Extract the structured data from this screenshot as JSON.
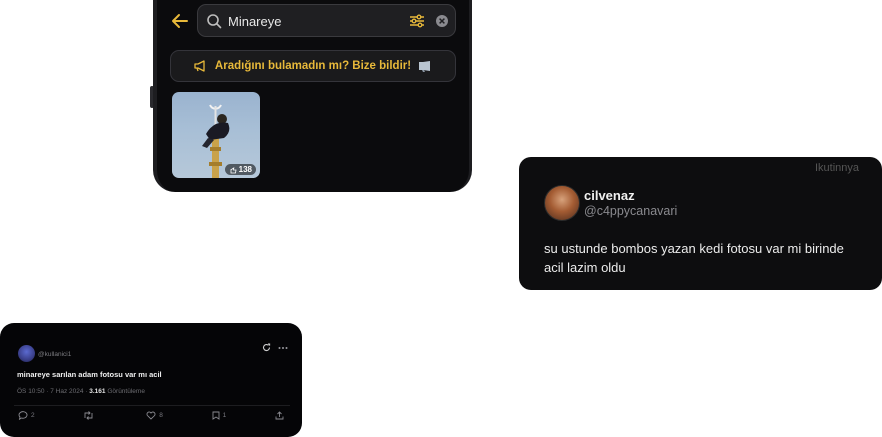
{
  "search_screen": {
    "query": "Minareye",
    "report_banner": "Aradığını bulamadın mı? Bize bildir!",
    "result": {
      "count": "138"
    }
  },
  "tweet_card": {
    "ghost_button": "Ikutinnya",
    "display_name": "cilvenaz",
    "handle": "@c4ppycanavari",
    "text": "su ustunde bombos yazan kedi fotosu var mi birinde acil lazim oldu"
  },
  "mini_tweet": {
    "handle": "@kullanici1",
    "text": "minareye sarılan adam fotosu var mı acil",
    "time": "ÖS 10:50 · 7 Haz 2024 · ",
    "views": "3.161",
    "views_label": " Görüntüleme",
    "actions": {
      "replies": "2",
      "retweets": "",
      "likes": "8",
      "bookmarks": "1"
    }
  },
  "colors": {
    "accent_yellow": "#e8b93a",
    "dark_bg": "#0b0b0d"
  },
  "icons": [
    "back-arrow-icon",
    "search-icon",
    "filter-icon",
    "clear-icon",
    "megaphone-icon",
    "speaker-icon",
    "views-icon",
    "refresh-icon",
    "more-icon",
    "reply-icon",
    "retweet-icon",
    "like-icon",
    "bookmark-icon",
    "share-icon"
  ]
}
